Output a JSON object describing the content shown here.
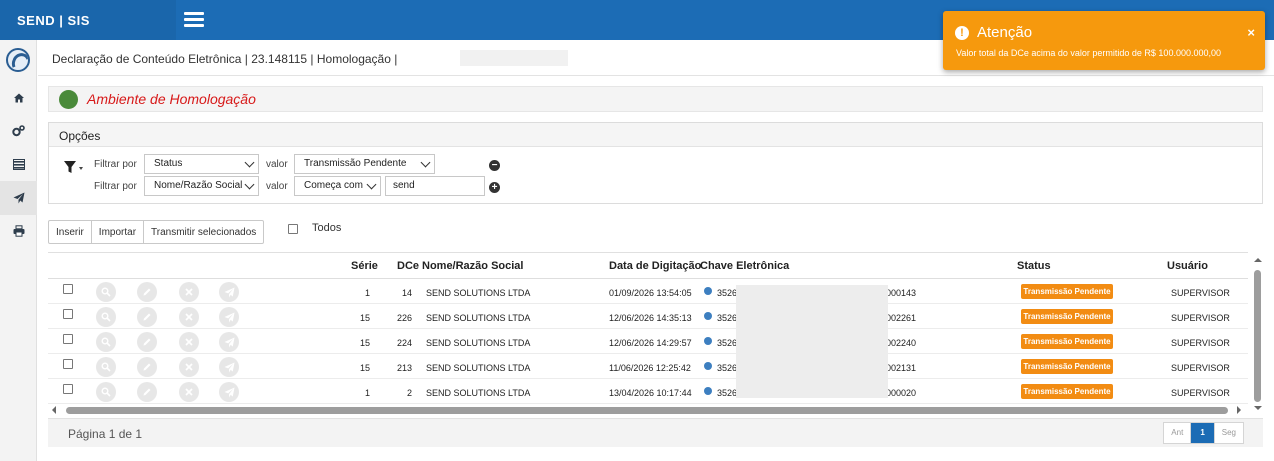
{
  "brand": "SEND | SIS",
  "page_header": {
    "title": "Declaração de Conteúdo Eletrônica | 23.148115 | Homologação |"
  },
  "environment": {
    "label": "Ambiente de Homologação",
    "color": "#4a8a3a"
  },
  "options": {
    "title": "Opções",
    "filters": [
      {
        "filter_label": "Filtrar por",
        "field": "Status",
        "value_label": "valor",
        "value": "Transmissão Pendente"
      },
      {
        "filter_label": "Filtrar por",
        "field": "Nome/Razão Social",
        "value_label": "valor",
        "operator": "Começa com",
        "value": "send"
      }
    ]
  },
  "toolbar": {
    "insert": "Inserir",
    "import": "Importar",
    "transmit_selected": "Transmitir selecionados",
    "all_label": "Todos"
  },
  "table": {
    "columns": [
      "Série",
      "DCe",
      "Nome/Razão Social",
      "Data de Digitação",
      "Chave Eletrônica",
      "Status",
      "Usuário"
    ],
    "rows": [
      {
        "serie": "1",
        "dce": "14",
        "name": "SEND SOLUTIONS LTDA",
        "date": "01/09/2026 13:54:05",
        "key_start": "3526(",
        "key_end": "000143",
        "status": "Transmissão Pendente",
        "user": "SUPERVISOR"
      },
      {
        "serie": "15",
        "dce": "226",
        "name": "SEND SOLUTIONS LTDA",
        "date": "12/06/2026 14:35:13",
        "key_start": "3526(",
        "key_end": "002261",
        "status": "Transmissão Pendente",
        "user": "SUPERVISOR"
      },
      {
        "serie": "15",
        "dce": "224",
        "name": "SEND SOLUTIONS LTDA",
        "date": "12/06/2026 14:29:57",
        "key_start": "3526(",
        "key_end": "002240",
        "status": "Transmissão Pendente",
        "user": "SUPERVISOR"
      },
      {
        "serie": "15",
        "dce": "213",
        "name": "SEND SOLUTIONS LTDA",
        "date": "11/06/2026 12:25:42",
        "key_start": "3526(",
        "key_end": "002131",
        "status": "Transmissão Pendente",
        "user": "SUPERVISOR"
      },
      {
        "serie": "1",
        "dce": "2",
        "name": "SEND SOLUTIONS LTDA",
        "date": "13/04/2026 10:17:44",
        "key_start": "3526(",
        "key_end": "000020",
        "status": "Transmissão Pendente",
        "user": "SUPERVISOR"
      }
    ]
  },
  "pagination": {
    "label": "Página 1 de 1",
    "prev": "Ant",
    "current": "1",
    "next": "Seg"
  },
  "toast": {
    "title": "Atenção",
    "message": "Valor total da DCe acima do valor permitido de R$ 100.000.000,00",
    "close": "×",
    "icon": "!"
  },
  "colors": {
    "primary": "#1c6cb5",
    "warning": "#f6990d",
    "status_badge": "#f28c13",
    "env_text": "#d71919"
  }
}
